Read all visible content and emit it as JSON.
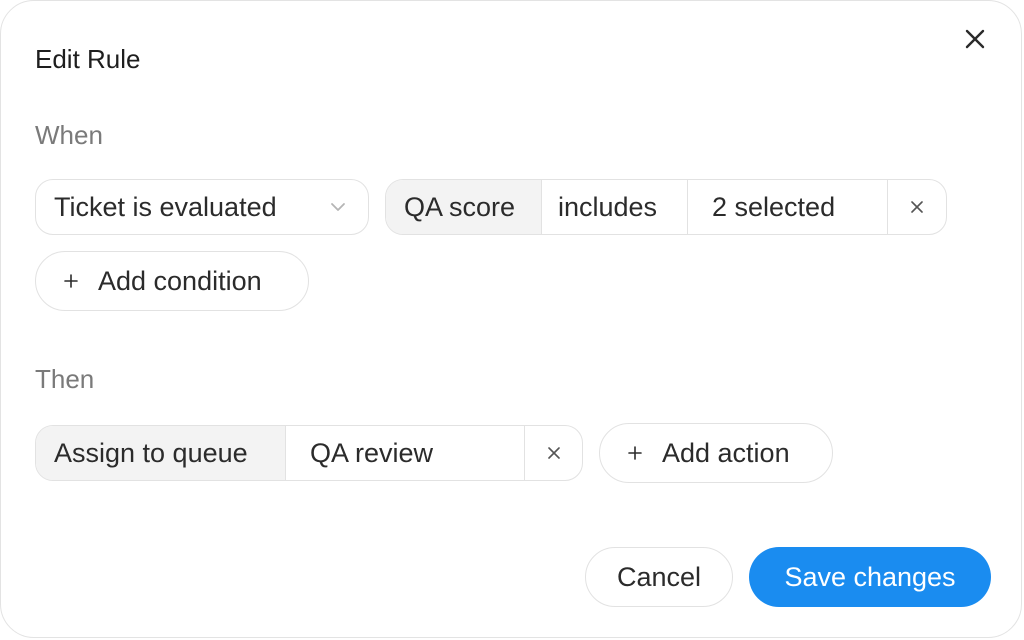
{
  "dialog": {
    "title": "Edit Rule",
    "close_icon": "close-icon"
  },
  "when": {
    "label": "When",
    "trigger": {
      "value": "Ticket is evaluated",
      "icon": "chevron-down-icon"
    },
    "condition": {
      "field": "QA score",
      "operator": "includes",
      "value": "2 selected",
      "remove_icon": "close-icon"
    },
    "add_condition_label": "Add condition"
  },
  "then": {
    "label": "Then",
    "action": {
      "type": "Assign to queue",
      "value": "QA review",
      "remove_icon": "close-icon"
    },
    "add_action_label": "Add action"
  },
  "footer": {
    "cancel_label": "Cancel",
    "save_label": "Save changes"
  },
  "colors": {
    "primary": "#1a8cf0",
    "segment_bg": "#f3f3f3",
    "border": "#e2e2e2",
    "muted_text": "#7a7a7a"
  }
}
